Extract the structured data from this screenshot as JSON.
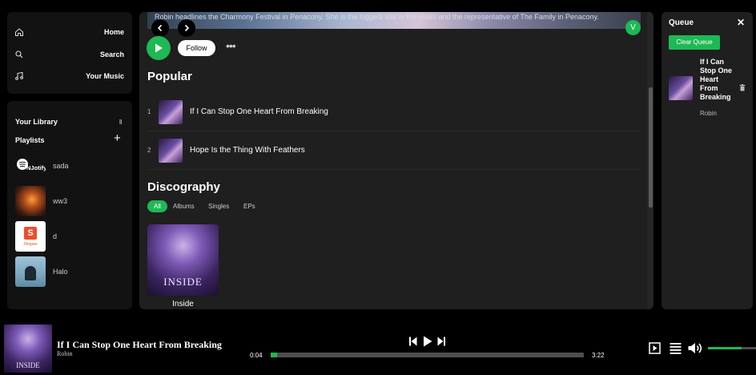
{
  "nav": {
    "home": "Home",
    "search": "Search",
    "your_music": "Your Music"
  },
  "library": {
    "title": "Your Library",
    "playlists_label": "Playlists",
    "playlists": [
      {
        "name": "sada",
        "logo_text": "NJotify"
      },
      {
        "name": "ww3"
      },
      {
        "name": "d",
        "logo_text": "Shopee"
      },
      {
        "name": "Halo"
      }
    ]
  },
  "artist": {
    "banner_text": "Robin headlines the Charmony Festival in Penacony. She is the biggest star in the realm and the representative of The Family in Penacony.",
    "follow_label": "Follow",
    "user_initial": "V"
  },
  "popular": {
    "heading": "Popular",
    "tracks": [
      {
        "num": "1",
        "title": "If I Can Stop One Heart From Breaking"
      },
      {
        "num": "2",
        "title": "Hope Is the Thing With Feathers"
      }
    ]
  },
  "discography": {
    "heading": "Discography",
    "filters": [
      "All",
      "Albums",
      "Singles",
      "EPs"
    ],
    "album": {
      "title": "Inside",
      "cover_text": "INSIDE"
    }
  },
  "queue": {
    "title": "Queue",
    "clear_label": "Clear Queue",
    "item": {
      "title": "If I Can Stop One Heart From Breaking",
      "artist": "Robin"
    }
  },
  "player": {
    "title": "If I Can Stop One Heart From Breaking",
    "artist": "Robin",
    "cover_text": "INSIDE",
    "elapsed": "0:04",
    "duration": "3:22",
    "progress": 0.02,
    "volume": 0.7
  },
  "colors": {
    "accent": "#1db954",
    "panel": "#121212",
    "main_panel": "#1f1f1f"
  }
}
